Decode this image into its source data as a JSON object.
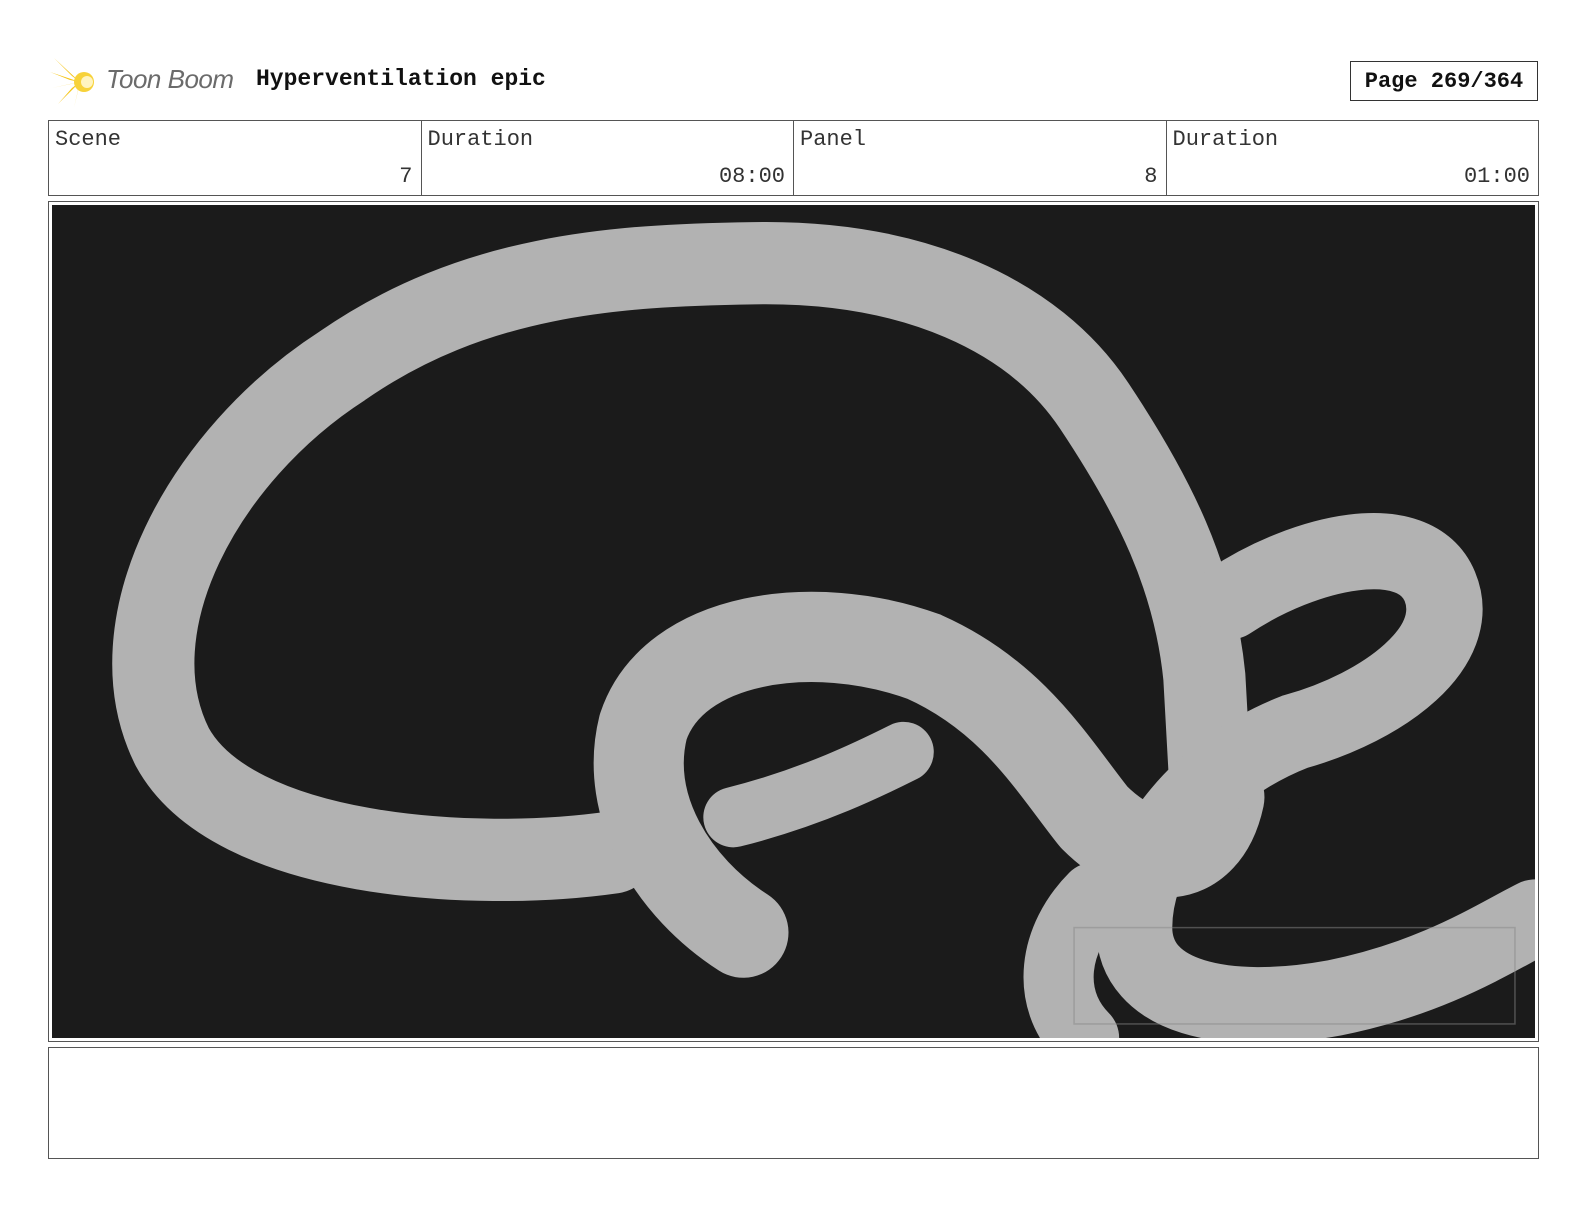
{
  "header": {
    "logo_text": "Toon Boom",
    "project_title": "Hyperventilation epic",
    "page_label": "Page 269/364"
  },
  "info": {
    "scene_label": "Scene",
    "scene_value": "7",
    "scene_duration_label": "Duration",
    "scene_duration_value": "08:00",
    "panel_label": "Panel",
    "panel_value": "8",
    "panel_duration_label": "Duration",
    "panel_duration_value": "01:00"
  },
  "panel": {
    "background_color": "#1b1b1b",
    "shape_color": "#b2b2b2"
  },
  "notes": {
    "text": ""
  }
}
